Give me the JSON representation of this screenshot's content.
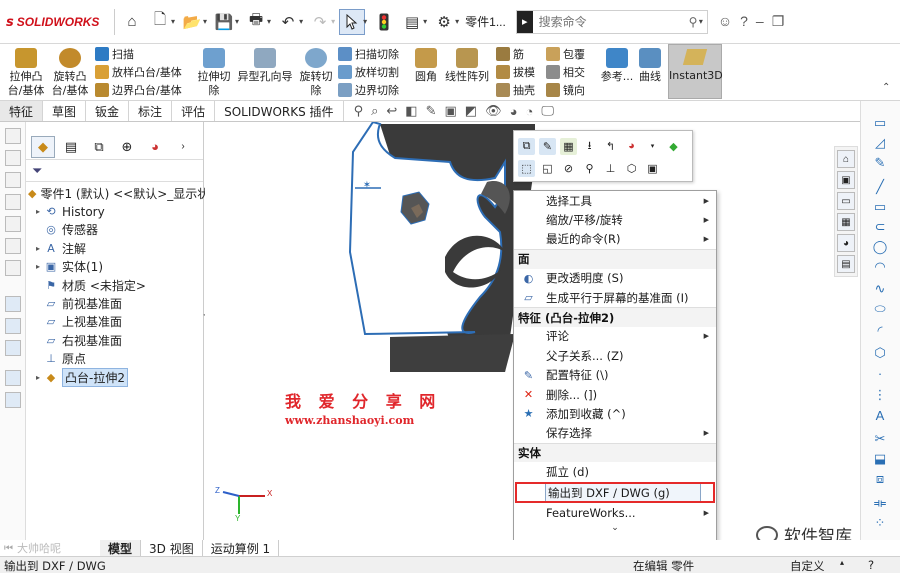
{
  "app": {
    "brand": "SOLIDWORKS",
    "document_name": "零件1...",
    "search_placeholder": "搜索命令"
  },
  "ribbon": {
    "extrude_boss": "拉伸凸\n台/基体",
    "revolve_boss": "旋转凸\n台/基体",
    "sweep": "扫描",
    "loft_boss": "放样凸台/基体",
    "boundary_boss": "边界凸台/基体",
    "extrude_cut": "拉伸切\n除",
    "hole_wizard": "异型孔向导",
    "revolve_cut": "旋转切\n除",
    "swept_cut": "扫描切除",
    "lofted_cut": "放样切割",
    "boundary_cut": "边界切除",
    "fillet": "圆角",
    "linear_pattern": "线性阵列",
    "rib": "筋",
    "draft": "拔模",
    "shell": "抽壳",
    "wrap": "包覆",
    "intersect": "相交",
    "mirror": "镜向",
    "reference": "参考...",
    "curves": "曲线",
    "instant3d": "Instant3D"
  },
  "cm_tabs": [
    "特征",
    "草图",
    "钣金",
    "标注",
    "评估",
    "SOLIDWORKS 插件"
  ],
  "tree": {
    "root": "零件1 (默认) <<默认>_显示状",
    "items": [
      {
        "label": "History",
        "icon": "history-icon",
        "expandable": true
      },
      {
        "label": "传感器",
        "icon": "sensor-icon",
        "expandable": false
      },
      {
        "label": "注解",
        "icon": "annotation-icon",
        "expandable": true
      },
      {
        "label": "实体(1)",
        "icon": "solid-bodies-icon",
        "expandable": true
      },
      {
        "label": "材质 <未指定>",
        "icon": "material-icon",
        "expandable": false
      },
      {
        "label": "前视基准面",
        "icon": "plane-icon",
        "expandable": false
      },
      {
        "label": "上视基准面",
        "icon": "plane-icon",
        "expandable": false
      },
      {
        "label": "右视基准面",
        "icon": "plane-icon",
        "expandable": false
      },
      {
        "label": "原点",
        "icon": "origin-icon",
        "expandable": false
      },
      {
        "label": "凸台-拉伸2",
        "icon": "boss-extrude-icon",
        "expandable": true,
        "selected": true
      }
    ]
  },
  "viewport": {
    "watermark_cn": "我 爱 分 享 网",
    "watermark_url": "www.zhanshaoyi.com",
    "axis_x": "X",
    "axis_y": "Y",
    "axis_z": "Z"
  },
  "context_menu": {
    "group1": [
      {
        "label": "选择工具",
        "submenu": true
      },
      {
        "label": "缩放/平移/旋转",
        "submenu": true
      },
      {
        "label": "最近的命令(R)",
        "submenu": true
      }
    ],
    "header_face": "面",
    "face_items": [
      {
        "label": "更改透明度 (S)",
        "icon": "transparency-icon"
      },
      {
        "label": "生成平行于屏幕的基准面 (I)",
        "icon": "plane-parallel-icon"
      }
    ],
    "header_feature": "特征 (凸台-拉伸2)",
    "feature_items": [
      {
        "label": "评论",
        "submenu": true
      },
      {
        "label": "父子关系... (Z)",
        "submenu": false
      },
      {
        "label": "配置特征 (\\)",
        "icon": "configure-icon"
      },
      {
        "label": "删除... (])",
        "icon": "delete-icon"
      },
      {
        "label": "添加到收藏 (^)",
        "icon": "favorite-icon"
      },
      {
        "label": "保存选择",
        "submenu": true
      }
    ],
    "header_body": "实体",
    "body_items": [
      {
        "label": "孤立 (d)"
      },
      {
        "label": "输出到 DXF / DWG (g)",
        "highlighted": true
      },
      {
        "label": "FeatureWorks...",
        "submenu": true
      }
    ]
  },
  "bottom_tabs": {
    "model": "模型",
    "view3d": "3D 视图",
    "motion": "运动算例 1",
    "watermark": "大帅哈呢"
  },
  "status": {
    "left": "输出到 DXF / DWG",
    "editing": "在编辑 零件",
    "custom": "自定义"
  },
  "brand_watermark": "软件智库",
  "colors": {
    "accent_red": "#e52a2a",
    "brand_red": "#d0111b",
    "selection_blue": "#cfe3f8"
  }
}
